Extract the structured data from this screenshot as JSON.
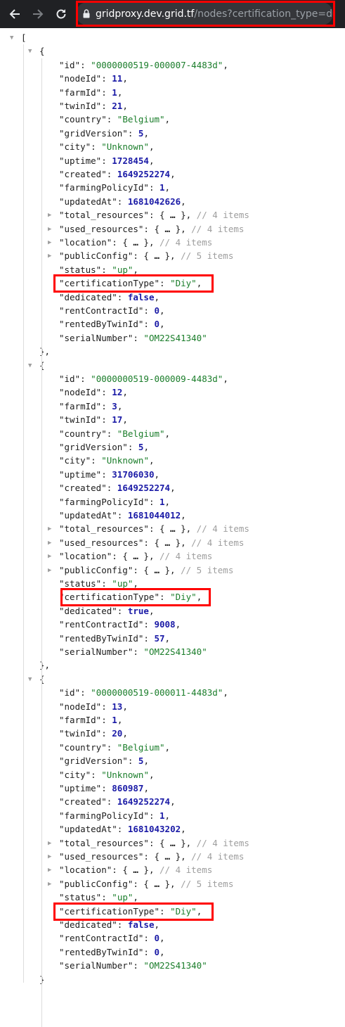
{
  "browser": {
    "url_host": "gridproxy.dev.grid.tf",
    "url_path": "/nodes?certification_type=diy"
  },
  "nodes": [
    {
      "id": "0000000519-000007-4483d",
      "nodeId": "11",
      "farmId": "1",
      "twinId": "21",
      "country": "Belgium",
      "gridVersion": "5",
      "city": "Unknown",
      "uptime": "1728454",
      "created": "1649252274",
      "farmingPolicyId": "1",
      "updatedAt": "1681042626",
      "total_resources_count": "4 items",
      "used_resources_count": "4 items",
      "location_count": "4 items",
      "publicConfig_count": "5 items",
      "status": "up",
      "certificationType": "Diy",
      "dedicated": "false",
      "rentContractId": "0",
      "rentedByTwinId": "0",
      "serialNumber": "OM22S41340"
    },
    {
      "id": "0000000519-000009-4483d",
      "nodeId": "12",
      "farmId": "3",
      "twinId": "17",
      "country": "Belgium",
      "gridVersion": "5",
      "city": "Unknown",
      "uptime": "31706030",
      "created": "1649252274",
      "farmingPolicyId": "1",
      "updatedAt": "1681044012",
      "total_resources_count": "4 items",
      "used_resources_count": "4 items",
      "location_count": "4 items",
      "publicConfig_count": "5 items",
      "status": "up",
      "certificationType": "Diy",
      "dedicated": "true",
      "rentContractId": "9008",
      "rentedByTwinId": "57",
      "serialNumber": "OM22S41340"
    },
    {
      "id": "0000000519-000011-4483d",
      "nodeId": "13",
      "farmId": "1",
      "twinId": "20",
      "country": "Belgium",
      "gridVersion": "5",
      "city": "Unknown",
      "uptime": "860987",
      "created": "1649252274",
      "farmingPolicyId": "1",
      "updatedAt": "1681043202",
      "total_resources_count": "4 items",
      "used_resources_count": "4 items",
      "location_count": "4 items",
      "publicConfig_count": "5 items",
      "status": "up",
      "certificationType": "Diy",
      "dedicated": "false",
      "rentContractId": "0",
      "rentedByTwinId": "0",
      "serialNumber": "OM22S41340"
    }
  ]
}
